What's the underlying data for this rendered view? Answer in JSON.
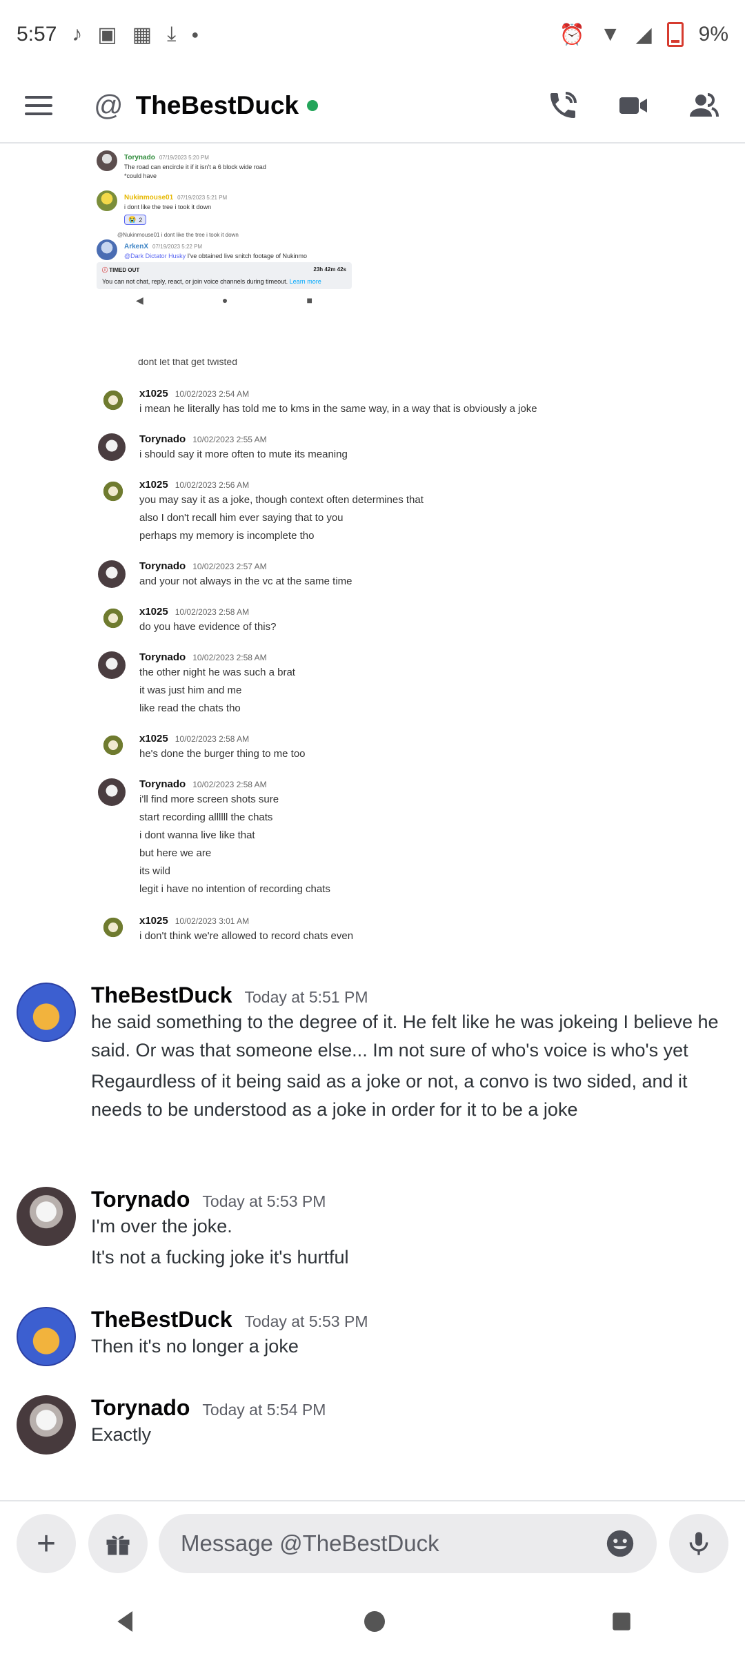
{
  "status_bar": {
    "time": "5:57",
    "battery": "9%"
  },
  "header": {
    "title": "TheBestDuck",
    "at_symbol": "@"
  },
  "embedded_screenshot": {
    "messages": [
      {
        "author": "Torynado",
        "time": "07/19/2023 5:20 PM",
        "lines": [
          "The road can encircle it if it isn't a 6 block wide road",
          "*could have"
        ]
      },
      {
        "author": "Nukinmouse01",
        "time": "07/19/2023 5:21 PM",
        "lines": [
          "i dont like the tree i took it down"
        ],
        "reaction_count": "2"
      }
    ],
    "reply_preview": "@Nukinmouse01 i dont like the tree i took it down",
    "reply_message": {
      "author": "ArkenX",
      "time": "07/19/2023 5:22 PM",
      "mention": "@Dark Dictator Husky",
      "text": "I've obtained live snitch footage of Nukinmo"
    },
    "timeout": {
      "label": "TIMED OUT",
      "remaining": "23h 42m 42s",
      "body": "You can not chat, reply, react, or join voice channels during timeout.",
      "link": "Learn more"
    }
  },
  "cut_off_line": "dont let that get twisted",
  "chat_log": [
    {
      "author": "x1025",
      "time": "10/02/2023 2:54 AM",
      "lines": [
        "i mean he literally has told me to kms in the same way, in a way that is obviously a joke"
      ]
    },
    {
      "author": "Torynado",
      "time": "10/02/2023 2:55 AM",
      "lines": [
        "i should say it more often to mute its meaning"
      ]
    },
    {
      "author": "x1025",
      "time": "10/02/2023 2:56 AM",
      "lines": [
        "you may say it as a joke, though context often determines that",
        "also I don't recall him ever saying that to you",
        "perhaps my memory is incomplete tho"
      ]
    },
    {
      "author": "Torynado",
      "time": "10/02/2023 2:57 AM",
      "lines": [
        "and your not always in the vc at the same time"
      ]
    },
    {
      "author": "x1025",
      "time": "10/02/2023 2:58 AM",
      "lines": [
        "do you have evidence of this?"
      ]
    },
    {
      "author": "Torynado",
      "time": "10/02/2023 2:58 AM",
      "lines": [
        "the other night he was such a brat",
        "it was just him and me",
        "like read the chats tho"
      ]
    },
    {
      "author": "x1025",
      "time": "10/02/2023 2:58 AM",
      "lines": [
        "he's done the burger thing to me too"
      ]
    },
    {
      "author": "Torynado",
      "time": "10/02/2023 2:58 AM",
      "lines": [
        "i'll find more screen shots sure",
        "start recording allllll the chats",
        "i dont wanna live like that",
        "but here we are",
        "its wild",
        "legit i have no intention of recording chats"
      ]
    },
    {
      "author": "x1025",
      "time": "10/02/2023 3:01 AM",
      "lines": [
        "i don't think we're allowed to record chats even"
      ]
    }
  ],
  "messages": [
    {
      "author": "TheBestDuck",
      "time": "Today at 5:51 PM",
      "paragraphs": [
        "he said something to the degree of it. He felt like he was jokeing I believe he said. Or was that someone else... Im not sure of who's voice is who's yet",
        "Regaurdless of it being said as a joke or not, a convo is two sided, and it needs to be understood as a joke in order for it to be a joke"
      ]
    },
    {
      "author": "Torynado",
      "time": "Today at 5:53 PM",
      "paragraphs": [
        "I'm over the joke.",
        "It's not a fucking joke it's hurtful"
      ]
    },
    {
      "author": "TheBestDuck",
      "time": "Today at 5:53 PM",
      "paragraphs": [
        "Then it's no longer a joke"
      ]
    },
    {
      "author": "Torynado",
      "time": "Today at 5:54 PM",
      "paragraphs": [
        "Exactly"
      ]
    }
  ],
  "composer": {
    "placeholder": "Message @TheBestDuck"
  },
  "colors": {
    "online": "#23a55a",
    "link": "#00a8fc",
    "timeout_warning": "#d83c3e"
  }
}
